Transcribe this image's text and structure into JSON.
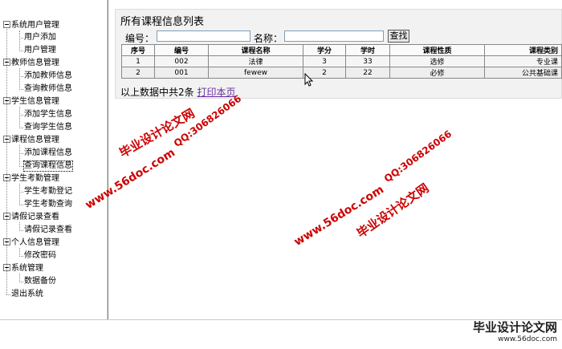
{
  "sidebar": {
    "groups": [
      {
        "label": "系统用户管理",
        "items": [
          "用户添加",
          "用户管理"
        ]
      },
      {
        "label": "教师信息管理",
        "items": [
          "添加教师信息",
          "查询教师信息"
        ]
      },
      {
        "label": "学生信息管理",
        "items": [
          "添加学生信息",
          "查询学生信息"
        ]
      },
      {
        "label": "课程信息管理",
        "items": [
          "添加课程信息",
          "查询课程信息"
        ]
      },
      {
        "label": "学生考勤管理",
        "items": [
          "学生考勤登记",
          "学生考勤查询"
        ]
      },
      {
        "label": "请假记录查看",
        "items": [
          "请假记录查看"
        ]
      },
      {
        "label": "个人信息管理",
        "items": [
          "修改密码"
        ]
      },
      {
        "label": "系统管理",
        "items": [
          "数据备份"
        ]
      }
    ],
    "logout": "退出系统"
  },
  "main": {
    "title": "所有课程信息列表",
    "search": {
      "code_label": "编号：",
      "name_label": "名称：",
      "code_value": "",
      "name_value": "",
      "button": "查找"
    },
    "table": {
      "headers": [
        "序号",
        "编号",
        "课程名称",
        "学分",
        "学时",
        "课程性质",
        "课程类别"
      ],
      "rows": [
        [
          "1",
          "002",
          "法律",
          "3",
          "33",
          "选修",
          "专业课"
        ],
        [
          "2",
          "001",
          "fewew",
          "2",
          "22",
          "必修",
          "公共基础课"
        ]
      ]
    },
    "footer": {
      "summary": "以上数据中共2条",
      "print_link": "打印本页"
    }
  },
  "watermarks": {
    "site_name": "毕业设计论文网",
    "url": "www.56doc.com",
    "qq": "QQ:306826066"
  },
  "brand": {
    "name": "毕业设计论文网",
    "url": "www.56doc.com"
  }
}
